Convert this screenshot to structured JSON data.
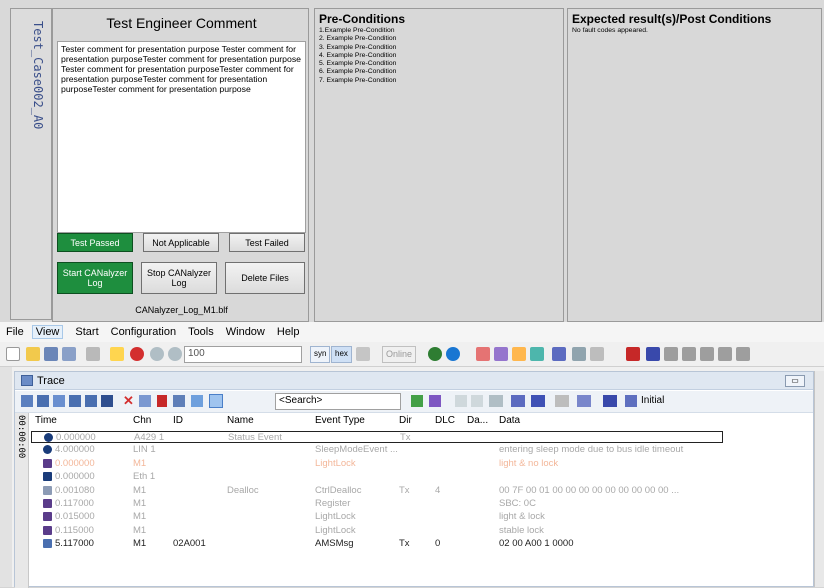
{
  "test_case_tab": "Test_Case002_A0",
  "comment_panel": {
    "title": "Test Engineer Comment",
    "text": "Tester comment for presentation purpose Tester comment for presentation purposeTester comment for presentation purpose Tester comment for presentation purposeTester comment for presentation purposeTester comment for presentation purposeTester comment for presentation purpose",
    "btn_passed": "Test Passed",
    "btn_na": "Not Applicable",
    "btn_failed": "Test Failed",
    "btn_start_log": "Start CANalyzer Log",
    "btn_stop_log": "Stop CANalyzer Log",
    "btn_delete": "Delete Files",
    "log_file": "CANalyzer_Log_M1.blf"
  },
  "preconditions": {
    "title": "Pre-Conditions",
    "items": [
      "1.Example Pre-Condition",
      "2. Example Pre-Condition",
      "3. Example Pre-Condition",
      "4. Example Pre-Condition",
      "5. Example Pre-Condition",
      "6. Example Pre-Condition",
      "7. Example Pre-Condition"
    ]
  },
  "expected": {
    "title": "Expected result(s)/Post Conditions",
    "text": "No fault codes appeared."
  },
  "menu": [
    "File",
    "View",
    "Start",
    "Configuration",
    "Tools",
    "Window",
    "Help"
  ],
  "toolbar": {
    "zoom_value": "100",
    "syn_label": "syn",
    "hex_label": "hex",
    "online_label": "Online"
  },
  "trace": {
    "title": "Trace",
    "search_placeholder": "<Search>",
    "initial_label": "Initial",
    "time_strip": "00:00:00",
    "columns": [
      "Time",
      "Chn",
      "ID",
      "Name",
      "Event Type",
      "Dir",
      "DLC",
      "Da...",
      "Data"
    ],
    "rows": [
      {
        "time": "0.000000",
        "chn": "A429 1",
        "id": "",
        "name": "Status Event",
        "type": "",
        "dir": "Tx",
        "dlc": "",
        "data": "",
        "style": "grey"
      },
      {
        "time": "4.000000",
        "chn": "LIN 1",
        "id": "",
        "name": "",
        "type": "SleepModeEvent ...",
        "dir": "",
        "dlc": "",
        "data": "entering sleep mode due to bus idle timeout",
        "style": "grey"
      },
      {
        "time": "0.000000",
        "chn": "M1",
        "id": "",
        "name": "",
        "type": "LightLock",
        "dir": "",
        "dlc": "",
        "data": "light & no lock",
        "style": "orange"
      },
      {
        "time": "0.000000",
        "chn": "Eth 1",
        "id": "",
        "name": "",
        "type": "",
        "dir": "",
        "dlc": "",
        "data": "",
        "style": "grey"
      },
      {
        "time": "0.001080",
        "chn": "M1",
        "id": "",
        "name": "Dealloc",
        "type": "CtrlDealloc",
        "dir": "Tx",
        "dlc": "4",
        "data": "00 7F 00 01 00 00 00 00 00 00 00 00 00 ...",
        "style": "grey"
      },
      {
        "time": "0.117000",
        "chn": "M1",
        "id": "",
        "name": "",
        "type": "Register",
        "dir": "",
        "dlc": "",
        "data": "SBC: 0C",
        "style": "grey"
      },
      {
        "time": "0.015000",
        "chn": "M1",
        "id": "",
        "name": "",
        "type": "LightLock",
        "dir": "",
        "dlc": "",
        "data": "light & lock",
        "style": "grey"
      },
      {
        "time": "0.115000",
        "chn": "M1",
        "id": "",
        "name": "",
        "type": "LightLock",
        "dir": "",
        "dlc": "",
        "data": "stable lock",
        "style": "grey"
      },
      {
        "time": "5.117000",
        "chn": "M1",
        "id": "02A001",
        "name": "",
        "type": "AMSMsg",
        "dir": "Tx",
        "dlc": "0",
        "data": "02 00 A00 1 0000",
        "style": "black"
      }
    ]
  },
  "colors": {
    "green_button": "#1e8e3e",
    "trace_header": "#dfe7f1",
    "grey_row": "#a8a8a8",
    "orange_row": "#f3b79a"
  }
}
